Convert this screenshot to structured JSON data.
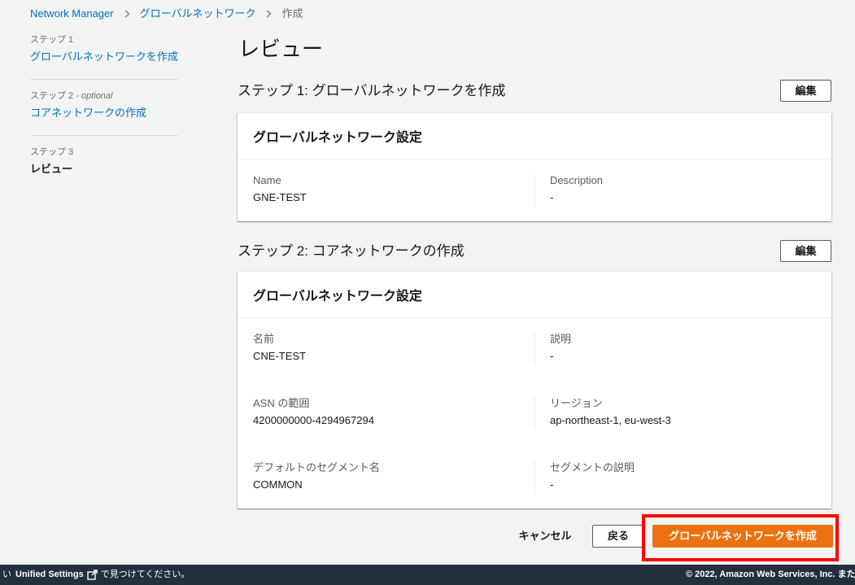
{
  "breadcrumb": [
    {
      "label": "Network Manager"
    },
    {
      "label": "グローバルネットワーク"
    },
    {
      "label": "作成"
    }
  ],
  "sidebar": {
    "steps": [
      {
        "step": "ステップ 1",
        "title": "グローバルネットワークを作成"
      },
      {
        "step": "ステップ 2",
        "optional": "- optional",
        "title": "コアネットワークの作成"
      },
      {
        "step": "ステップ 3",
        "title": "レビュー",
        "current": true
      }
    ]
  },
  "page_title": "レビュー",
  "sections": [
    {
      "heading": "ステップ 1: グローバルネットワークを作成",
      "edit_label": "編集",
      "card_title": "グローバルネットワーク設定",
      "rows": [
        [
          {
            "label": "Name",
            "value": "GNE-TEST"
          },
          {
            "label": "Description",
            "value": "-"
          }
        ]
      ]
    },
    {
      "heading": "ステップ 2: コアネットワークの作成",
      "edit_label": "編集",
      "card_title": "グローバルネットワーク設定",
      "rows": [
        [
          {
            "label": "名前",
            "value": "CNE-TEST"
          },
          {
            "label": "説明",
            "value": "-"
          }
        ],
        [
          {
            "label": "ASN の範囲",
            "value": "4200000000-4294967294"
          },
          {
            "label": "リージョン",
            "value": "ap-northeast-1, eu-west-3"
          }
        ],
        [
          {
            "label": "デフォルトのセグメント名",
            "value": "COMMON"
          },
          {
            "label": "セグメントの説明",
            "value": "-"
          }
        ]
      ]
    }
  ],
  "actions": {
    "cancel_label": "キャンセル",
    "back_label": "戻る",
    "create_label": "グローバルネットワークを作成"
  },
  "footer": {
    "left_cut": "い",
    "left_link": "Unified Settings",
    "left_text": "で見つけてください。",
    "copyright": "© 2022, Amazon Web Services, Inc. また"
  },
  "icons": {
    "breadcrumb_separator": "chevron-right-icon",
    "footer_link": "external-link-icon"
  },
  "colors": {
    "page_bg": "#f2f3f3",
    "text": "#16191f",
    "link": "#0073bb",
    "primary_button": "#ec7211",
    "footer_bg": "#232f3e",
    "highlight": "#ff0000"
  }
}
